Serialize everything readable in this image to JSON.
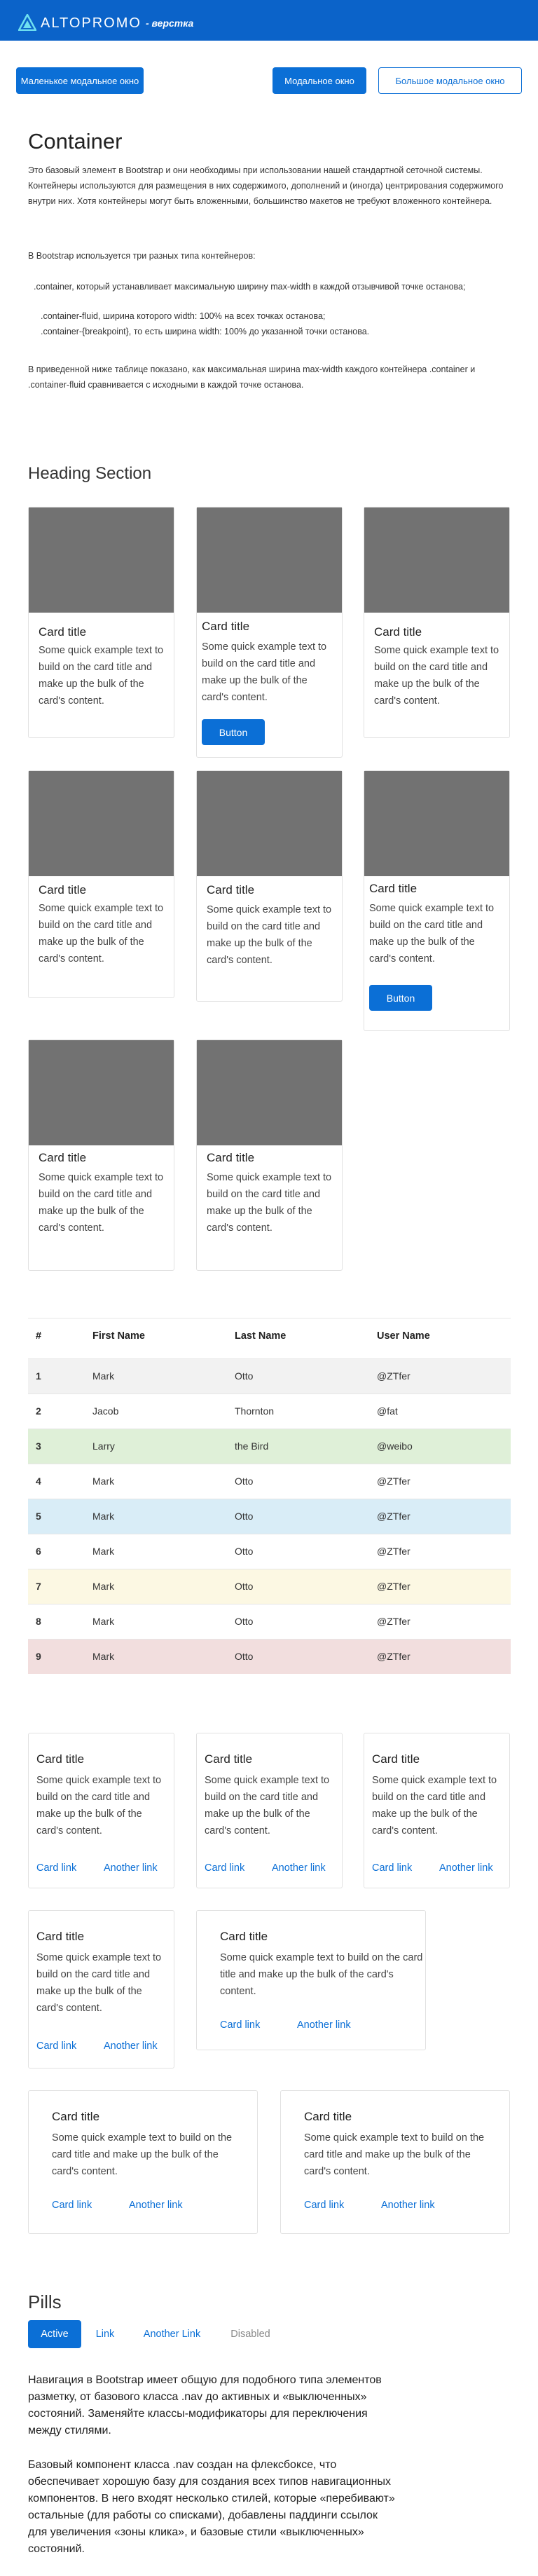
{
  "header": {
    "logo_text": "ALTOPROMO",
    "logo_sub": "- верстка"
  },
  "modal_buttons": {
    "small": "Маленькое модальное окно",
    "normal": "Модальное окно",
    "large": "Большое модальное окно"
  },
  "container_section": {
    "title": "Container",
    "p1": "Это базовый элемент в Bootstrap и они необходимы при использовании нашей стандартной сеточной системы. Контейнеры используются для размещения в них содержимого, дополнений и (иногда) центрирования содержимого внутри них. Хотя контейнеры могут быть вложенными, большинство макетов не требуют вложенного контейнера.",
    "p2": "В Bootstrap используется три разных типа контейнеров:",
    "list1": ".container, который устанавливает максимальную ширину max-width в каждой отзывчивой точке останова;",
    "list2": ".container-fluid, ширина которого width: 100% на всех точках останова;",
    "list3": ".container-{breakpoint}, то есть ширина width: 100% до указанной точки останова.",
    "p3": "В приведенной ниже таблице показано, как максимальная ширина max-width каждого контейнера .container и .container-fluid сравнивается с исходными в каждой точке останова."
  },
  "heading_section": {
    "title": "Heading Section"
  },
  "card": {
    "title": "Card title",
    "text": "Some quick example text to build on the card title and make up the bulk of the card's content.",
    "button": "Button",
    "link1": "Card link",
    "link2": "Another link"
  },
  "table": {
    "headers": [
      "#",
      "First Name",
      "Last Name",
      "User Name"
    ],
    "rows": [
      [
        "1",
        "Mark",
        "Otto",
        "@ZTfer"
      ],
      [
        "2",
        "Jacob",
        "Thornton",
        "@fat"
      ],
      [
        "3",
        "Larry",
        "the Bird",
        "@weibo"
      ],
      [
        "4",
        "Mark",
        "Otto",
        "@ZTfer"
      ],
      [
        "5",
        "Mark",
        "Otto",
        "@ZTfer"
      ],
      [
        "6",
        "Mark",
        "Otto",
        "@ZTfer"
      ],
      [
        "7",
        "Mark",
        "Otto",
        "@ZTfer"
      ],
      [
        "8",
        "Mark",
        "Otto",
        "@ZTfer"
      ],
      [
        "9",
        "Mark",
        "Otto",
        "@ZTfer"
      ]
    ],
    "row_colors": [
      "#f2f2f2",
      "#ffffff",
      "#dff0d8",
      "#ffffff",
      "#d9edf7",
      "#ffffff",
      "#fcf8e3",
      "#ffffff",
      "#f2dede"
    ]
  },
  "pills": {
    "title": "Pills",
    "items": [
      "Active",
      "Link",
      "Another Link",
      "Disabled"
    ],
    "text1": "Навигация в Bootstrap имеет общую для подобного типа элементов разметку, от базового класса .nav до активных и «выключенных» состояний. Заменяйте классы-модификаторы для переключения между стилями.",
    "text2": "Базовый компонент класса .nav создан на флексбоксе, что обеспечивает хорошую базу для создания всех типов навигационных компонентов. В него входят несколько стилей, которые «перебивают» остальные (для работы со списками), добавлены паддинги ссылок для увеличения «зоны клика», и базовые стили «выключенных» состояний."
  },
  "colors": {
    "brand": "#0b63c9",
    "primary": "#0b6fd6",
    "card_image": "#727272"
  }
}
